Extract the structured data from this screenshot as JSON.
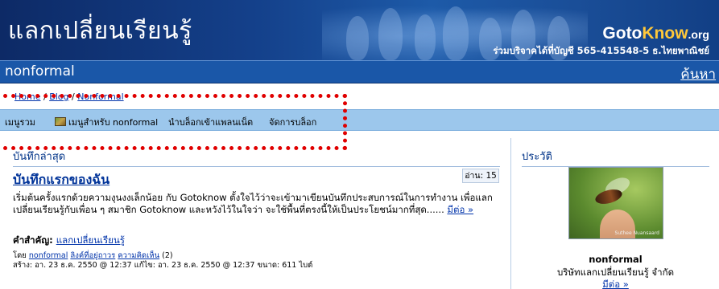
{
  "header": {
    "site_title": "แลกเปลี่ยนเรียนรู้",
    "brand_goto": "Goto",
    "brand_know": "Know",
    "brand_org": ".org",
    "donate_text": "ร่วมบริจาคได้ที่บัญชี 565-415548-5 ธ.ไทยพาณิชย์"
  },
  "blogbar": {
    "blog_name": "nonformal",
    "search_label": "ค้นหา"
  },
  "breadcrumb": {
    "items": [
      "Home",
      "Blog",
      "Nonformal"
    ],
    "separator": "/"
  },
  "menu": {
    "items": [
      "เมนูรวม",
      "เมนูสำหรับ nonformal",
      "นำบล็อกเข้าแพลนเน็ต",
      "จัดการบล็อก"
    ]
  },
  "main": {
    "section_title": "บันทึกล่าสุด",
    "post": {
      "title": "บันทึกแรกของฉัน",
      "reads": "อ่าน: 15",
      "excerpt": "เริ่มต้นครั้งแรกด้วยความงุนงงเล็กน้อย กับ Gotoknow ตั้งใจไว้ว่าจะเข้ามาเขียนบันทึกประสบการณ์ในการทำงาน เพื่อแลกเปลี่ยนเรียนรู้กับเพื่อน ๆ สมาชิก Gotoknow  และหวังไว้ในใจว่า จะใช้พื้นที่ตรงนี้ให้เป็นประโยชน์มากที่สุด......",
      "more_link": "มีต่อ »",
      "keyword_label": "คำสำคัญ:",
      "keyword": "แลกเปลี่ยนเรียนรู้",
      "by_label": "โดย",
      "author": "nonformal",
      "link_label": "ลิงค์ที่อยู่ถาวร",
      "comments_label": "ความคิดเห็น",
      "comments_count": "(2)",
      "dates_line": "สร้าง: อา. 23 ธ.ค. 2550 @ 12:37   แก้ไข: อา. 23 ธ.ค. 2550 @ 12:37   ขนาด: 611 ไบต์"
    }
  },
  "sidebar": {
    "section_title": "ประวัติ",
    "photo_caption": "Suthee Nuansaard",
    "name": "nonformal",
    "org": "บริษัทแลกเปลี่ยนเรียนรู้ จำกัด",
    "more_link": "มีต่อ »"
  },
  "colors": {
    "banner": "#14408a",
    "blogbar": "#1a57a8",
    "menubar": "#9cc7ec",
    "link": "#0033aa",
    "annotation": "#e00000"
  }
}
